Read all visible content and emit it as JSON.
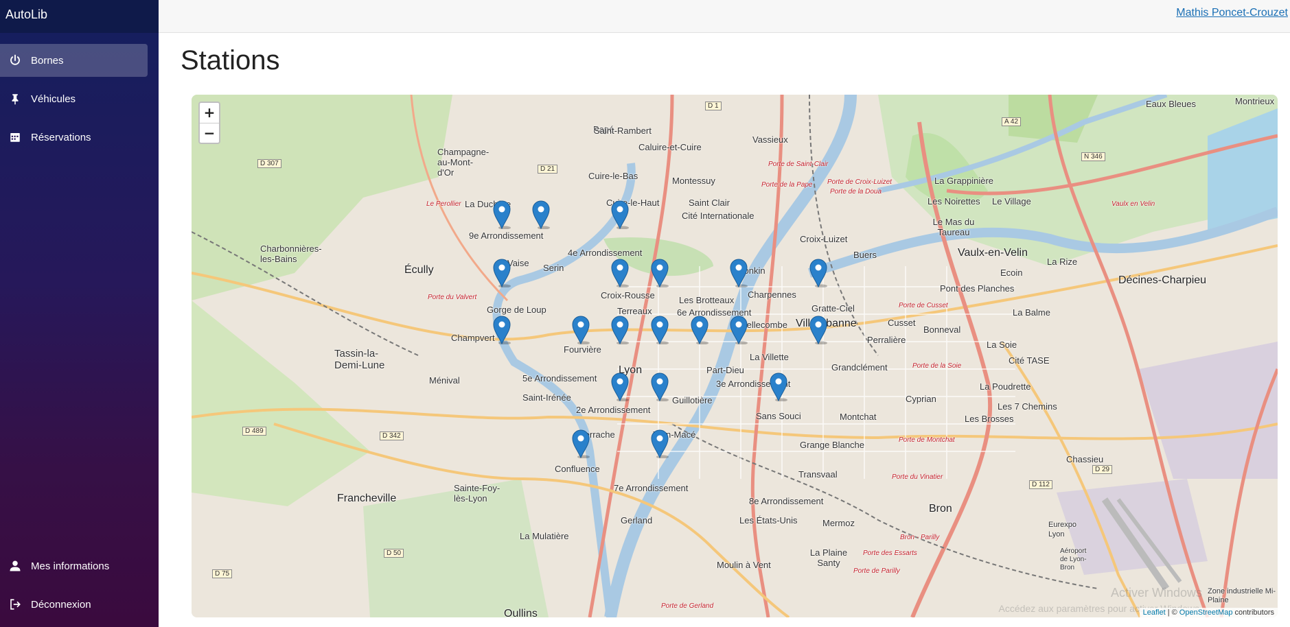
{
  "app": {
    "brand": "AutoLib"
  },
  "sidebar": {
    "items": [
      {
        "label": "Bornes",
        "icon": "power-icon",
        "active": true
      },
      {
        "label": "Véhicules",
        "icon": "pin-icon",
        "active": false
      },
      {
        "label": "Réservations",
        "icon": "calendar-icon",
        "active": false
      }
    ],
    "bottom_items": [
      {
        "label": "Mes informations",
        "icon": "user-icon"
      },
      {
        "label": "Déconnexion",
        "icon": "logout-icon"
      }
    ]
  },
  "header": {
    "user": "Mathis Poncet-Crouzet"
  },
  "page": {
    "title": "Stations"
  },
  "map": {
    "zoom_in": "+",
    "zoom_out": "−",
    "marker_color": "#2a81cb",
    "marker_count": 20,
    "attribution": {
      "leaflet": "Leaflet",
      "sep": "| ©",
      "osm": "OpenStreetMap",
      "suffix": "contributors"
    },
    "places": {
      "p1": "Saint-Rambert",
      "p2": "Caluire-et-Cuire",
      "p3": "Vassieux",
      "p4": "Champagne-au-Mont-d'Or",
      "p5": "Cuire-le-Bas",
      "p6": "Montessuy",
      "p7": "La Duchère",
      "p8": "Cuire-le-Haut",
      "p9": "Saint Clair",
      "p10": "Cité Internationale",
      "p11": "9e Arrondissement",
      "p12": "4e Arrondissement",
      "p13": "Vaise",
      "p14": "Serin",
      "p15": "Écully",
      "p16": "Charbonnières-les-Bains",
      "p17": "Gorge de Loup",
      "p18": "Croix-Rousse",
      "p19": "Terreaux",
      "p20": "Les Brotteaux",
      "p21": "6e Arrondissement",
      "p22": "Charpennes",
      "p23": "Tonkin",
      "p24": "Croix-Luizet",
      "p25": "Buers",
      "p26": "Gratte-Ciel",
      "p27": "Villeurbanne",
      "p28": "Bellecombe",
      "p29": "Champvert",
      "p30": "Fourvière",
      "p31": "Tassin-la-Demi-Lune",
      "p32": "Lyon",
      "p33": "La Villette",
      "p34": "Part-Dieu",
      "p35": "3e Arrondissement",
      "p36": "Grandclément",
      "p37": "Perralière",
      "p38": "Ménival",
      "p39": "5e Arrondissement",
      "p40": "Saint-Irénée",
      "p41": "2e Arrondissement",
      "p42": "Guillotière",
      "p43": "Sans Souci",
      "p44": "Montchat",
      "p45": "Cyprian",
      "p46": "Perrache",
      "p47": "Jean-Macé",
      "p48": "Confluence",
      "p49": "7e Arrondissement",
      "p50": "Transvaal",
      "p51": "Grange Blanche",
      "p52": "8e Arrondissement",
      "p53": "Gerland",
      "p54": "Les États-Unis",
      "p55": "Mermoz",
      "p56": "Bron",
      "p57": "Francheville",
      "p58": "Sainte-Foy-lès-Lyon",
      "p59": "La Mulatière",
      "p60": "Moulin à Vent",
      "p61": "La Plaine Santy",
      "p62": "Oullins",
      "p63": "La Grappinière",
      "p64": "Les Noirettes",
      "p65": "Le Village",
      "p66": "Le Mas du Taureau",
      "p67": "Vaulx-en-Velin",
      "p68": "La Rize",
      "p69": "Ecoin",
      "p70": "Pont des Planches",
      "p71": "Décines-Charpieu",
      "p72": "La Balme",
      "p73": "Bonneval",
      "p74": "Cusset",
      "p75": "La Soie",
      "p76": "Cité TASE",
      "p77": "La Poudrette",
      "p78": "Les 7 Chemins",
      "p79": "Les Brosses",
      "p80": "Chassieu",
      "p81": "Eurexpo Lyon",
      "p82": "Aéroport de Lyon-Bron",
      "p83": "Zone industrielle Mi-Plaine",
      "p84": "Eaux Bleues",
      "p85": "Papé",
      "p86": "Montrieux"
    },
    "roads": {
      "r1": "Porte de Saint-Clair",
      "r2": "Porte de Croix-Luizet",
      "r3": "Porte de la Doua",
      "r4": "Porte de la Pape",
      "r5": "Porte de Cusset",
      "r6": "Porte de la Soie",
      "r7": "Porte de Montchat",
      "r8": "Porte du Vinatier",
      "r9": "Porte des Essarts",
      "r10": "Porte de Parilly",
      "r11": "Porte du Valvert",
      "r12": "Le Perollier",
      "r13": "Vaulx en Velin",
      "r14": "Bron - Parilly",
      "r15": "Porte de Gerland"
    },
    "badges": {
      "b1": "D 1",
      "b2": "D 21",
      "b3": "D 307",
      "b4": "A 42",
      "b5": "N 346",
      "b6": "D 489",
      "b7": "D 342",
      "b8": "D 50",
      "b9": "D 75",
      "b10": "D 29",
      "b11": "D 112"
    },
    "watermark": {
      "line1": "Activer Windows",
      "line2": "Accédez aux paramètres pour activer Windows."
    }
  }
}
